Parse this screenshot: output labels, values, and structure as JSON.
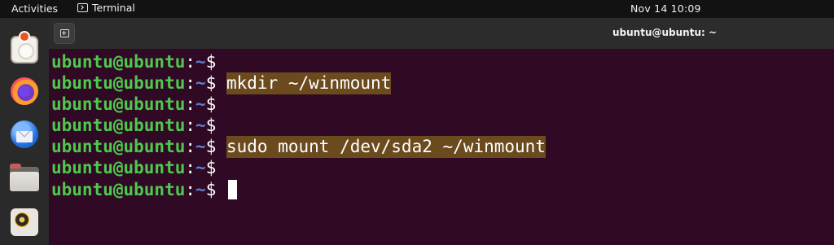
{
  "topbar": {
    "activities": "Activities",
    "app_name": "Terminal",
    "clock": "Nov 14  10:09"
  },
  "dock": {
    "items": [
      {
        "name": "ubuntu-installer",
        "icon": "installer-disc-icon"
      },
      {
        "name": "firefox",
        "icon": "firefox-icon"
      },
      {
        "name": "thunderbird",
        "icon": "thunderbird-icon"
      },
      {
        "name": "files",
        "icon": "folder-icon"
      },
      {
        "name": "rhythmbox",
        "icon": "speaker-icon"
      }
    ]
  },
  "window": {
    "title": "ubuntu@ubuntu: ~",
    "new_tab_icon": "new-tab-icon"
  },
  "terminal": {
    "prompt_user": "ubuntu@ubuntu",
    "prompt_colon": ":",
    "prompt_path": "~",
    "prompt_symbol": "$",
    "lines": [
      {
        "command": ""
      },
      {
        "command": "mkdir ~/winmount"
      },
      {
        "command": ""
      },
      {
        "command": ""
      },
      {
        "command": "sudo mount /dev/sda2 ~/winmount"
      },
      {
        "command": ""
      },
      {
        "command": ""
      }
    ]
  },
  "colors": {
    "terminal_bg": "#300a24",
    "prompt_user": "#4ec94e",
    "prompt_path": "#5b7fd6",
    "command_highlight": "#6b4a1e"
  }
}
